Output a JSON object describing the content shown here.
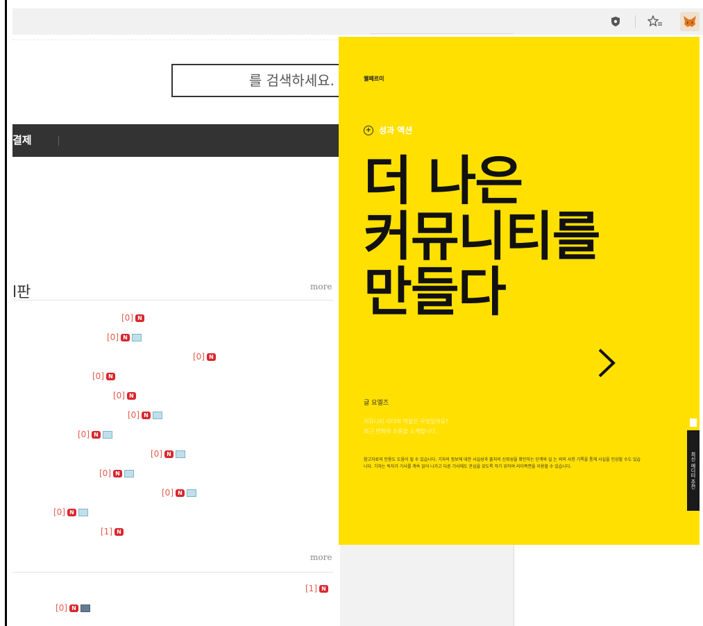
{
  "browser": {
    "icons": [
      "shield-icon",
      "star-favorites-icon",
      "metamask-fox-icon"
    ]
  },
  "search": {
    "placeholder": "를 검색하세요."
  },
  "nav": {
    "first_item": "결제"
  },
  "boards": [
    {
      "title": "l판",
      "more_label": "more",
      "posts": [
        {
          "count": "[0]",
          "new": true,
          "image": false
        },
        {
          "count": "[0]",
          "new": true,
          "image": true
        },
        {
          "count": "[0]",
          "new": true,
          "image": false
        },
        {
          "count": "[0]",
          "new": true,
          "image": false
        },
        {
          "count": "[0]",
          "new": true,
          "image": false
        },
        {
          "count": "[0]",
          "new": true,
          "image": true
        },
        {
          "count": "[0]",
          "new": true,
          "image": true
        },
        {
          "count": "[0]",
          "new": true,
          "image": true
        },
        {
          "count": "[0]",
          "new": true,
          "image": true
        },
        {
          "count": "[0]",
          "new": true,
          "image": true
        },
        {
          "count": "[0]",
          "new": true,
          "image": true
        },
        {
          "count": "[1]",
          "new": true,
          "image": false
        }
      ]
    },
    {
      "title": "",
      "more_label": "more",
      "posts": [
        {
          "count": "[1]",
          "new": true,
          "image": false
        },
        {
          "count": "[0]",
          "new": true,
          "image": true
        }
      ]
    }
  ],
  "overlay": {
    "background_color": "#ffe000",
    "brand": "웰페르미",
    "tag": "성과 액션",
    "headline": [
      "더 나은",
      "커뮤니티를",
      "만들다"
    ],
    "next_icon": "chevron-right-icon",
    "author": "글 요엘즈",
    "subtitle": [
      "커뮤니티 리더의 역할은 무엇일까요?",
      "최근 변화의 흐름을 소개합니다."
    ],
    "body": "참고자료의 인용도 도움이 될 수 있습니다. 기자의 정보에 대한 사실성과 출처의 신뢰성을 확인하는 단계와 일 는 외의 사항 기록을 통해 사실을 인상할 수도 있습니다. 기자는 독자가 기사를 계속 읽어 나가고 다른 기사에도 관심을 갖도록 하기 위하여 리더쪽면을 이용할 수 있습니다.",
    "side_tab": "최신 에디터 추천"
  }
}
